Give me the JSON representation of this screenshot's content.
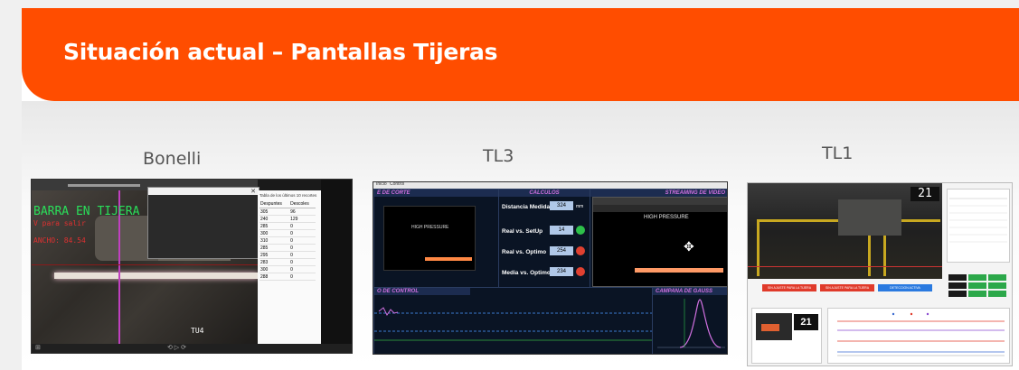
{
  "slide": {
    "title": "Situación actual – Pantallas Tijeras",
    "accent_color": "#ff4d00"
  },
  "screens": [
    {
      "label": "Bonelli",
      "overlay_line1": "BARRA EN TIJERA",
      "overlay_line2": "V para salir",
      "overlay_ancho": "ANCHO: 84.54",
      "overlay_id": "TU4",
      "table_title": "Tabla de los últimos 10 recortes",
      "table_headers": [
        "Despuntes",
        "Descoles"
      ],
      "table_rows": [
        [
          "305",
          "96"
        ],
        [
          "240",
          "129"
        ],
        [
          "285",
          "0"
        ],
        [
          "300",
          "0"
        ],
        [
          "310",
          "0"
        ],
        [
          "285",
          "0"
        ],
        [
          "295",
          "0"
        ],
        [
          "283",
          "0"
        ],
        [
          "300",
          "0"
        ],
        [
          "288",
          "0"
        ]
      ]
    },
    {
      "label": "TL3",
      "tabs": [
        "Inicio",
        "Control"
      ],
      "panel_corte": "E DE CORTE",
      "panel_calculos": "CALCULOS",
      "panel_video": "STREAMING DE VIDEO",
      "panel_control": "O DE CONTROL",
      "panel_gauss": "CAMPANA DE GAUSS",
      "camera_text": "HIGH PRESSURE",
      "metrics": [
        {
          "label": "Distancia Medida",
          "value": "324",
          "unit": "mm"
        },
        {
          "label": "Real vs. SetUp",
          "value": "14",
          "unit": ""
        },
        {
          "label": "Real vs. Optimo",
          "value": "254",
          "unit": ""
        },
        {
          "label": "Media vs. Optimo",
          "value": "234",
          "unit": ""
        }
      ]
    },
    {
      "label": "TL1",
      "counter": "21",
      "mini_counter": "21",
      "buttons": [
        "SIN AJUSTE PARA LA TIJERA",
        "SIN AJUSTE PARA LA TIJERA",
        "DETECCION ACTIVA"
      ]
    }
  ]
}
